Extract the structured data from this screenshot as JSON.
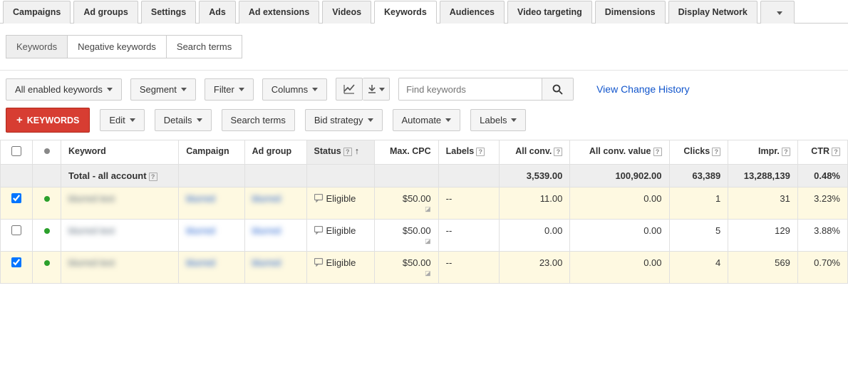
{
  "topTabs": {
    "items": [
      "Campaigns",
      "Ad groups",
      "Settings",
      "Ads",
      "Ad extensions",
      "Videos",
      "Keywords",
      "Audiences",
      "Video targeting",
      "Dimensions",
      "Display Network"
    ],
    "activeIndex": 6
  },
  "subTabs": {
    "items": [
      "Keywords",
      "Negative keywords",
      "Search terms"
    ],
    "activeIndex": 0
  },
  "toolbar1": {
    "filter_all": "All enabled keywords",
    "segment": "Segment",
    "filter": "Filter",
    "columns": "Columns",
    "search_placeholder": "Find keywords",
    "change_history": "View Change History"
  },
  "toolbar2": {
    "add_keywords": "KEYWORDS",
    "edit": "Edit",
    "details": "Details",
    "search_terms": "Search terms",
    "bid_strategy": "Bid strategy",
    "automate": "Automate",
    "labels": "Labels"
  },
  "table": {
    "headers": {
      "keyword": "Keyword",
      "campaign": "Campaign",
      "adgroup": "Ad group",
      "status": "Status",
      "maxcpc": "Max. CPC",
      "labels": "Labels",
      "allconv": "All conv.",
      "allconvval": "All conv. value",
      "clicks": "Clicks",
      "impr": "Impr.",
      "ctr": "CTR"
    },
    "total_label": "Total - all account",
    "totals": {
      "allconv": "3,539.00",
      "allconvval": "100,902.00",
      "clicks": "63,389",
      "impr": "13,288,139",
      "ctr": "0.48%"
    },
    "rows": [
      {
        "selected": true,
        "status_dot": "green",
        "keyword": "blurred text",
        "campaign": "blurred",
        "adgroup": "blurred",
        "status": "Eligible",
        "maxcpc": "$50.00",
        "labels": "--",
        "allconv": "11.00",
        "allconvval": "0.00",
        "clicks": "1",
        "impr": "31",
        "ctr": "3.23%"
      },
      {
        "selected": false,
        "status_dot": "green",
        "keyword": "blurred text",
        "campaign": "blurred",
        "adgroup": "blurred",
        "status": "Eligible",
        "maxcpc": "$50.00",
        "labels": "--",
        "allconv": "0.00",
        "allconvval": "0.00",
        "clicks": "5",
        "impr": "129",
        "ctr": "3.88%"
      },
      {
        "selected": true,
        "status_dot": "green",
        "keyword": "blurred text",
        "campaign": "blurred",
        "adgroup": "blurred",
        "status": "Eligible",
        "maxcpc": "$50.00",
        "labels": "--",
        "allconv": "23.00",
        "allconvval": "0.00",
        "clicks": "4",
        "impr": "569",
        "ctr": "0.70%"
      }
    ]
  }
}
